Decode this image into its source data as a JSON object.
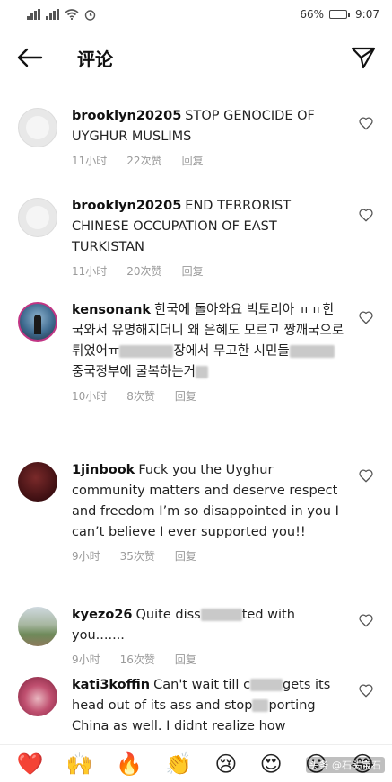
{
  "status_bar": {
    "battery": "66%",
    "battery_level": 0.66,
    "time": "9:07"
  },
  "header": {
    "title": "评论",
    "back_icon": "arrow-left-icon",
    "send_icon": "paper-plane-icon"
  },
  "comments": [
    {
      "username": "brooklyn20205",
      "text": "STOP GENOCIDE OF UYGHUR MUSLIMS",
      "time": "11小时",
      "likes": "22次赞",
      "reply": "回复",
      "avatar": "blank-avatar"
    },
    {
      "username": "brooklyn20205",
      "text": "END TERRORIST CHINESE OCCUPATION OF EAST TURKISTAN",
      "time": "11小时",
      "likes": "20次赞",
      "reply": "回复",
      "avatar": "blank-avatar"
    },
    {
      "username": "kensonank",
      "text_a": "한국에 돌아와요 빅토리아 ㅠㅠ한국와서 유명해지더니 왜 은혜도 모르고 짱깨국으로 튀었어ㅠ",
      "text_b": "장에서 무고한 시민들",
      "text_c": "중국정부에 굴복하는거",
      "time": "10小时",
      "likes": "8次赞",
      "reply": "回复",
      "avatar": "photo-avatar"
    },
    {
      "username": "1jinbook",
      "text": "Fuck you the Uyghur community matters and deserve respect and freedom I’m so disappointed in you I can’t believe I ever supported you!!",
      "time": "9小时",
      "likes": "35次赞",
      "reply": "回复",
      "avatar": "dark-avatar"
    },
    {
      "username": "kyezo26",
      "text_a": "Quite diss",
      "text_b": "ted with you.......",
      "time": "9小时",
      "likes": "16次赞",
      "reply": "回复",
      "avatar": "landscape-avatar"
    },
    {
      "username": "kati3koffin",
      "text_a": "Can't wait till c",
      "text_b": "gets its head out of its ass and stop",
      "text_c": "porting China as well. I didnt realize how",
      "avatar": "pink-avatar"
    }
  ],
  "emoji_bar": [
    "❤️",
    "🙌",
    "🔥",
    "👏",
    "😢",
    "😍",
    "😮",
    "😂"
  ],
  "watermark": "头条 @石头宝石"
}
